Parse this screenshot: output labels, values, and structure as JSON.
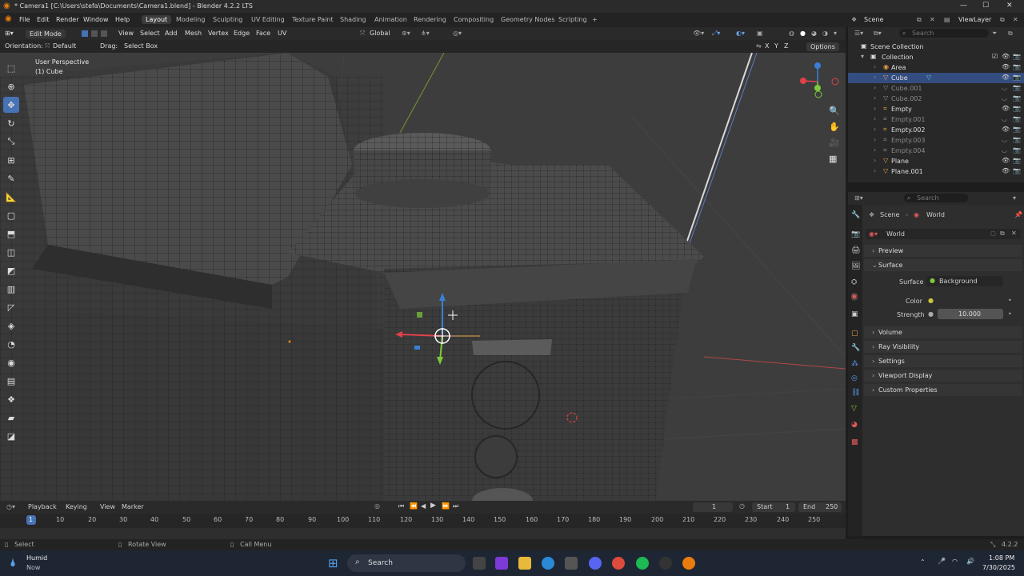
{
  "window": {
    "title": "* Camera1 [C:\\Users\\stefa\\Documents\\Camera1.blend] - Blender 4.2.2 LTS",
    "min": "—",
    "max": "☐",
    "close": "✕"
  },
  "menubar": {
    "items": [
      "File",
      "Edit",
      "Render",
      "Window",
      "Help"
    ],
    "workspaces": [
      "Layout",
      "Modeling",
      "Sculpting",
      "UV Editing",
      "Texture Paint",
      "Shading",
      "Animation",
      "Rendering",
      "Compositing",
      "Geometry Nodes",
      "Scripting"
    ],
    "active_workspace": "Layout",
    "add_tab": "+",
    "scene_label": "Scene",
    "viewlayer_label": "ViewLayer"
  },
  "viewport_header": {
    "mode": "Edit Mode",
    "menus": [
      "View",
      "Select",
      "Add",
      "Mesh",
      "Vertex",
      "Edge",
      "Face",
      "UV"
    ],
    "transform": "Global",
    "orientation_label": "Orientation:",
    "orientation_value": "Default",
    "drag_label": "Drag:",
    "drag_value": "Select Box",
    "options": "Options",
    "axis_x": "X",
    "axis_y": "Y",
    "axis_z": "Z"
  },
  "viewport": {
    "perspective": "User Perspective",
    "object": "(1) Cube"
  },
  "outliner": {
    "search_placeholder": "Search",
    "scene_collection": "Scene Collection",
    "collection": "Collection",
    "items": [
      {
        "name": "Area",
        "visible": true
      },
      {
        "name": "Cube",
        "visible": true,
        "selected": true
      },
      {
        "name": "Cube.001",
        "visible": false
      },
      {
        "name": "Cube.002",
        "visible": false
      },
      {
        "name": "Empty",
        "visible": true
      },
      {
        "name": "Empty.001",
        "visible": false
      },
      {
        "name": "Empty.002",
        "visible": true
      },
      {
        "name": "Empty.003",
        "visible": false
      },
      {
        "name": "Empty.004",
        "visible": false
      },
      {
        "name": "Plane",
        "visible": true
      },
      {
        "name": "Plane.001",
        "visible": true
      }
    ]
  },
  "properties": {
    "search_placeholder": "Search",
    "breadcrumb": [
      "Scene",
      "World"
    ],
    "world_name": "World",
    "sections": {
      "preview": "Preview",
      "surface": "Surface",
      "volume": "Volume",
      "ray_visibility": "Ray Visibility",
      "settings": "Settings",
      "viewport_display": "Viewport Display",
      "custom_properties": "Custom Properties"
    },
    "surface_label": "Surface",
    "surface_value": "Background",
    "color_label": "Color",
    "strength_label": "Strength",
    "strength_value": "10.000"
  },
  "timeline": {
    "menus": [
      "Playback",
      "Keying",
      "View",
      "Marker"
    ],
    "current_frame": "1",
    "start_label": "Start",
    "start_value": "1",
    "end_label": "End",
    "end_value": "250",
    "ticks": [
      "1",
      "10",
      "20",
      "30",
      "40",
      "50",
      "60",
      "70",
      "80",
      "90",
      "100",
      "110",
      "120",
      "130",
      "140",
      "150",
      "160",
      "170",
      "180",
      "190",
      "200",
      "210",
      "220",
      "230",
      "240",
      "250"
    ]
  },
  "statusbar": {
    "select": "Select",
    "rotate": "Rotate View",
    "call_menu": "Call Menu",
    "version": "4.2.2"
  },
  "taskbar": {
    "weather_title": "Humid",
    "weather_sub": "Now",
    "search": "Search",
    "time": "1:08 PM",
    "date": "7/30/2025"
  },
  "colors": {
    "accent": "#4772b3",
    "selection_row": "#334d80",
    "axis_red": "#e0414a",
    "axis_green": "#7ec83b",
    "axis_blue": "#3a7fd6"
  }
}
